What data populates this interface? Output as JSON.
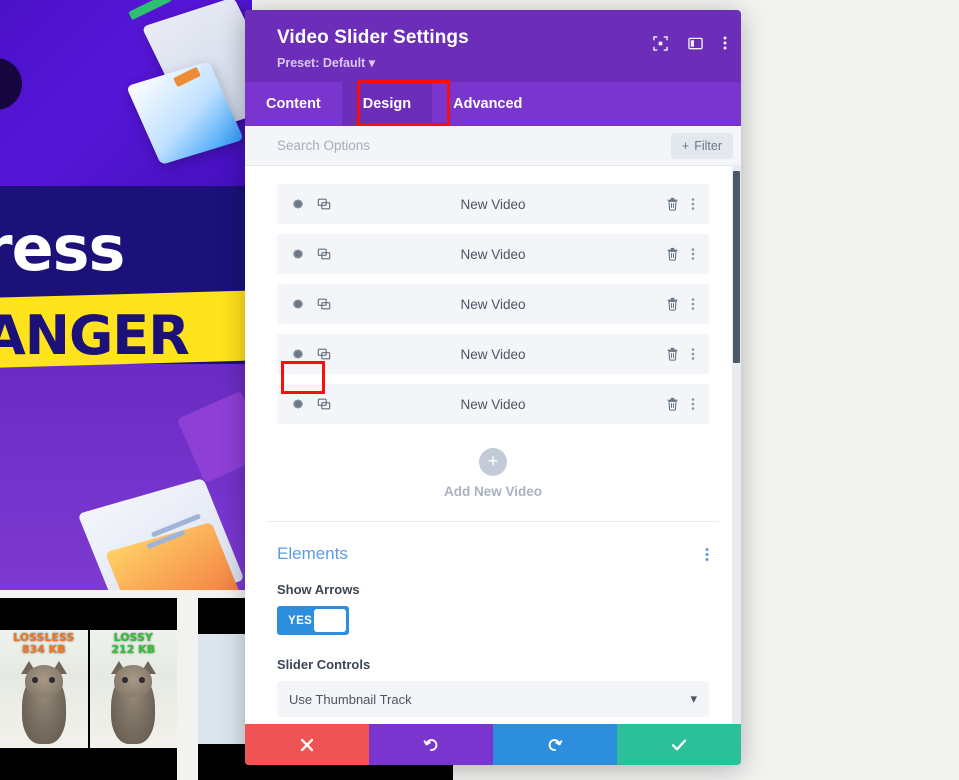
{
  "modal": {
    "title": "Video Slider Settings",
    "preset": "Preset: Default",
    "header_icons": [
      {
        "name": "focus-icon",
        "label": "Focus mode"
      },
      {
        "name": "layout-panel-icon",
        "label": "Change modal position"
      },
      {
        "name": "more-vertical-icon",
        "label": "More options"
      }
    ],
    "tabs": [
      {
        "id": "content",
        "label": "Content",
        "active": false
      },
      {
        "id": "design",
        "label": "Design",
        "active": true
      },
      {
        "id": "advanced",
        "label": "Advanced",
        "active": false
      }
    ],
    "search": {
      "placeholder": "Search Options",
      "value": "",
      "filter_label": "Filter",
      "filter_plus": "+"
    },
    "video_rows": [
      {
        "label": "New Video"
      },
      {
        "label": "New Video"
      },
      {
        "label": "New Video"
      },
      {
        "label": "New Video"
      },
      {
        "label": "New Video"
      }
    ],
    "add_new": {
      "plus": "+",
      "label": "Add New Video"
    },
    "elements_section": {
      "title": "Elements",
      "show_arrows_label": "Show Arrows",
      "show_arrows_value": "YES",
      "slider_controls_label": "Slider Controls",
      "slider_controls_value": "Use Thumbnail Track",
      "chevron": "▾"
    },
    "footer_buttons": [
      {
        "id": "cancel",
        "icon": "close-icon",
        "color": "#ef5353"
      },
      {
        "id": "undo",
        "icon": "undo-icon",
        "color": "#7b35cf"
      },
      {
        "id": "redo",
        "icon": "redo-icon",
        "color": "#2e8ede"
      },
      {
        "id": "save",
        "icon": "check-icon",
        "color": "#2bbf9a"
      }
    ]
  },
  "annotations": [
    {
      "name": "design-tab-highlight",
      "color": "#f60f0f"
    },
    {
      "name": "first-row-gear-highlight",
      "color": "#f60f0f"
    }
  ],
  "background": {
    "banner_word_1": "ress",
    "banner_word_2": "ANGER",
    "thumb_lossless_title": "LOSSLESS",
    "thumb_lossless_size": "834 KB",
    "thumb_lossy_title": "LOSSY",
    "thumb_lossy_size": "212 KB"
  },
  "colors": {
    "header_purple": "#6c2eb9",
    "tabbar_purple": "#7b35cf",
    "accent_blue": "#5b9bea",
    "toggle_blue": "#2e8ede",
    "annotation_red": "#f60f0f"
  }
}
